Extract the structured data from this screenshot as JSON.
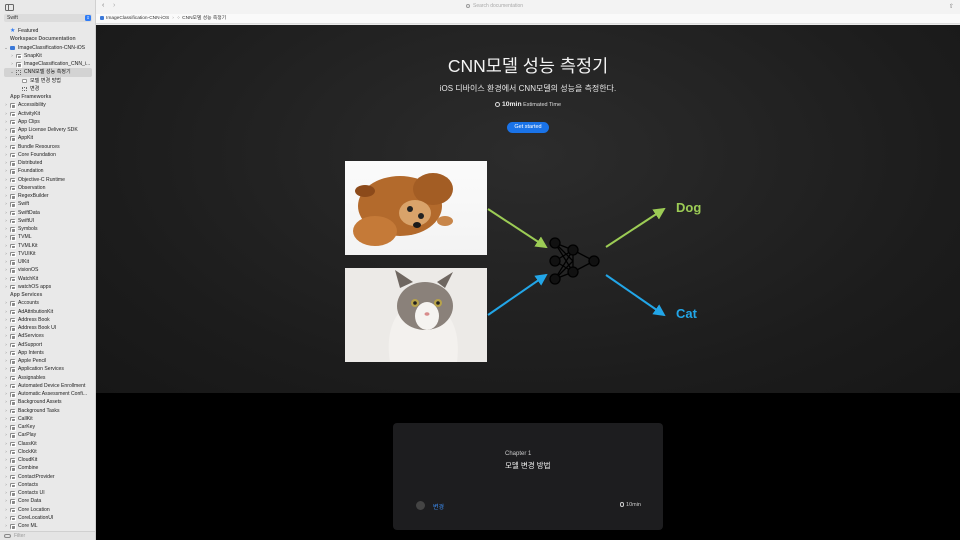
{
  "sidebar": {
    "scheme": "Swift",
    "featured_label": "Featured",
    "section_workspace": "Workspace Documentation",
    "workspace_items": [
      {
        "label": "ImageClassification-CNN-iOS",
        "indent": 0,
        "chev": "⌄",
        "icon": "blue"
      },
      {
        "label": "SnapKit",
        "indent": 1,
        "chev": "›",
        "icon": "fw"
      },
      {
        "label": "ImageClassification_CNN_i...",
        "indent": 1,
        "chev": "›",
        "icon": "fw"
      },
      {
        "label": "CNN모델 성능 측정기",
        "indent": 1,
        "chev": "⌄",
        "icon": "dots",
        "selected": true
      },
      {
        "label": "모델 변경 방법",
        "indent": 2,
        "chev": "",
        "icon": "page"
      },
      {
        "label": "변경",
        "indent": 2,
        "chev": "",
        "icon": "dots"
      }
    ],
    "section_frameworks": "App Frameworks",
    "frameworks": [
      "Accessibility",
      "ActivityKit",
      "App Clips",
      "App License Delivery SDK",
      "AppKit",
      "Bundle Resources",
      "Core Foundation",
      "Distributed",
      "Foundation",
      "Objective-C Runtime",
      "Observation",
      "RegexBuilder",
      "Swift",
      "SwiftData",
      "SwiftUI",
      "Symbols",
      "TVML",
      "TVMLKit",
      "TVUIKit",
      "UIKit",
      "visionOS",
      "WatchKit",
      "watchOS apps"
    ],
    "section_services": "App Services",
    "services": [
      "Accounts",
      "AdAttributionKit",
      "Address Book",
      "Address Book UI",
      "AdServices",
      "AdSupport",
      "App Intents",
      "Apple Pencil",
      "Application Services",
      "Assignables",
      "Automated Device Enrollment",
      "Automatic Assessment Confi...",
      "Background Assets",
      "Background Tasks",
      "CallKit",
      "CarKey",
      "CarPlay",
      "ClassKit",
      "ClockKit",
      "CloudKit",
      "Combine",
      "ContactProvider",
      "Contacts",
      "Contacts UI",
      "Core Data",
      "Core Location",
      "CoreLocationUI",
      "Core ML"
    ],
    "filter_placeholder": "Filter"
  },
  "toolbar": {
    "back": "‹",
    "forward": "›",
    "search_placeholder": "Search documentation",
    "share": "⇧"
  },
  "breadcrumb": {
    "project": "ImageClassification-CNN-iOS",
    "separator": "›",
    "page": "CNN모델 성능 측정기"
  },
  "hero": {
    "title": "CNN모델 성능 측정기",
    "subtitle": "iOS 디바이스 환경에서 CNN모델의 성능을 측정한다.",
    "time_value": "10min",
    "time_label": "Estimated Time",
    "start_label": "Get started",
    "dog_label": "Dog",
    "cat_label": "Cat",
    "colors": {
      "dog": "#9ccc55",
      "cat": "#22a6e8",
      "button": "#1a73e8"
    }
  },
  "chapter": {
    "number": "Chapter 1",
    "title": "모델 변경 방법",
    "link": "변경",
    "time": "10min"
  }
}
